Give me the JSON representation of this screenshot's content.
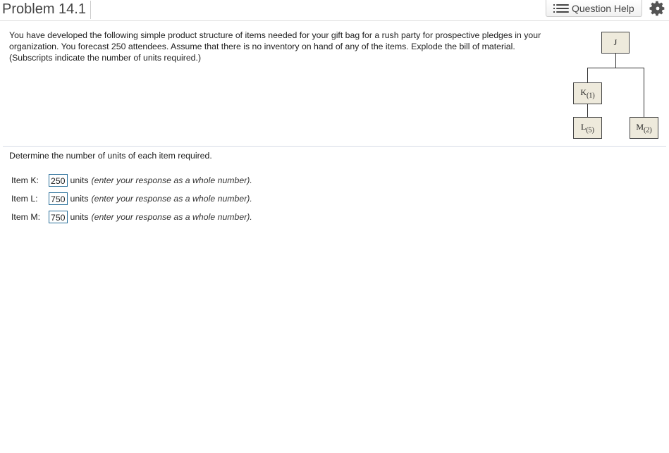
{
  "header": {
    "problem_title": "Problem 14.1",
    "help_label": "Question Help"
  },
  "problem": {
    "text": "You have developed the following simple product structure of items needed for your gift bag for a rush party for prospective pledges in your organization. You forecast 250 attendees. Assume that there is no inventory on hand of any of the items. Explode the bill of material. (Subscripts indicate the number of units required.)"
  },
  "tree": {
    "root": "J",
    "k": {
      "letter": "K",
      "sub": "(1)"
    },
    "l": {
      "letter": "L",
      "sub": "(5)"
    },
    "m": {
      "letter": "M",
      "sub": "(2)"
    }
  },
  "question": "Determine the number of units of each item required.",
  "answers": [
    {
      "label": "Item K:",
      "value": "250",
      "units": "units",
      "hint": "(enter your response as a whole number)."
    },
    {
      "label": "Item L:",
      "value": "750",
      "units": "units",
      "hint": "(enter your response as a whole number)."
    },
    {
      "label": "Item M:",
      "value": "750",
      "units": "units",
      "hint": "(enter your response as a whole number)."
    }
  ],
  "icons": {
    "help": "list-icon",
    "settings": "gear-icon"
  }
}
